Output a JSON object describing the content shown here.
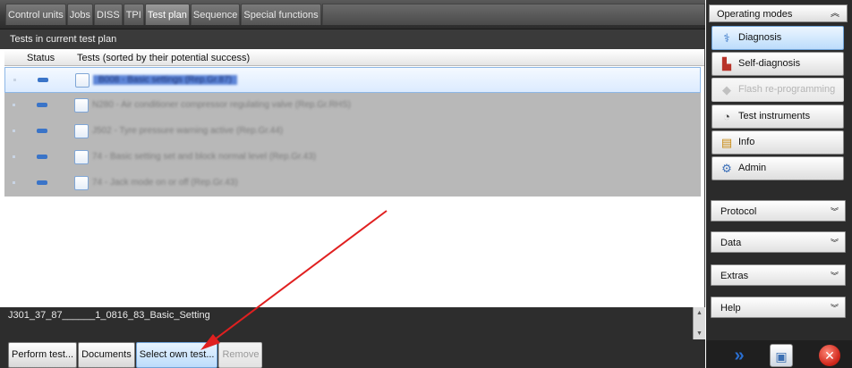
{
  "tabs": [
    "Control units",
    "Jobs",
    "DISS",
    "TPI",
    "Test plan",
    "Sequence",
    "Special functions"
  ],
  "active_tab_index": 4,
  "section_title": "Tests in current test plan",
  "columns": {
    "status": "Status",
    "tests": "Tests (sorted by their potential success)"
  },
  "tests": [
    {
      "label": "B008 - Basic settings (Rep.Gr.87)",
      "active": true
    },
    {
      "label": "N280 - Air conditioner compressor regulating valve (Rep.Gr.RHS)",
      "active": false
    },
    {
      "label": "J502 - Tyre pressure warning active (Rep.Gr.44)",
      "active": false
    },
    {
      "label": "74 - Basic setting set and block normal level (Rep.Gr.43)",
      "active": false
    },
    {
      "label": "74 - Jack mode on or off (Rep.Gr.43)",
      "active": false
    }
  ],
  "path_text": "J301_37_87______1_0816_83_Basic_Setting",
  "buttons": {
    "perform": "Perform test...",
    "documents": "Documents",
    "select_own": "Select own test...",
    "remove": "Remove"
  },
  "sidebar": {
    "header": "Operating modes",
    "modes": [
      {
        "label": "Diagnosis",
        "icon": "stethoscope-icon",
        "state": "on"
      },
      {
        "label": "Self-diagnosis",
        "icon": "car-icon",
        "state": "normal"
      },
      {
        "label": "Flash re-programming",
        "icon": "flash-icon",
        "state": "disabled"
      },
      {
        "label": "Test instruments",
        "icon": "gauge-icon",
        "state": "normal"
      },
      {
        "label": "Info",
        "icon": "book-icon",
        "state": "normal"
      },
      {
        "label": "Admin",
        "icon": "gear-icon",
        "state": "normal"
      }
    ],
    "sections": [
      "Protocol",
      "Data",
      "Extras",
      "Help"
    ]
  },
  "colors": {
    "accent": "#6fa3d8",
    "dark_bg": "#2d2d2d",
    "annotation_arrow": "#e02020"
  }
}
